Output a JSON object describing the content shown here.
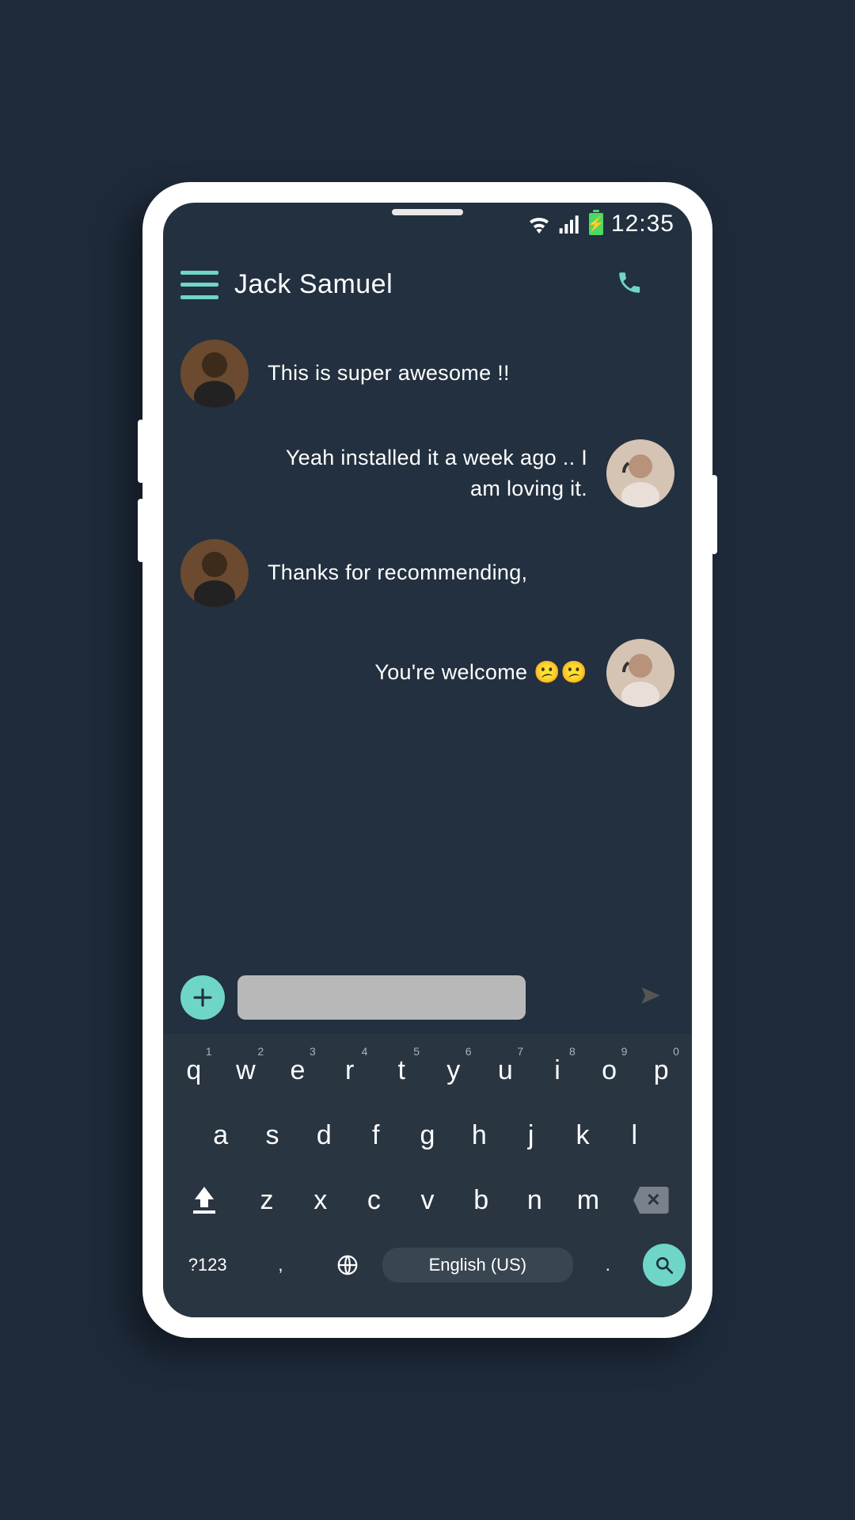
{
  "status": {
    "time": "12:35"
  },
  "header": {
    "contact_name": "Jack Samuel"
  },
  "messages": [
    {
      "dir": "in",
      "text": "This is super awesome !!"
    },
    {
      "dir": "out",
      "text": "Yeah installed it a week ago .. I am loving it."
    },
    {
      "dir": "in",
      "text": "Thanks for recommending,"
    },
    {
      "dir": "out",
      "text": "You're welcome 😕😕"
    }
  ],
  "input": {
    "value": ""
  },
  "keyboard": {
    "row1": [
      {
        "k": "q",
        "s": "1"
      },
      {
        "k": "w",
        "s": "2"
      },
      {
        "k": "e",
        "s": "3"
      },
      {
        "k": "r",
        "s": "4"
      },
      {
        "k": "t",
        "s": "5"
      },
      {
        "k": "y",
        "s": "6"
      },
      {
        "k": "u",
        "s": "7"
      },
      {
        "k": "i",
        "s": "8"
      },
      {
        "k": "o",
        "s": "9"
      },
      {
        "k": "p",
        "s": "0"
      }
    ],
    "row2": [
      "a",
      "s",
      "d",
      "f",
      "g",
      "h",
      "j",
      "k",
      "l"
    ],
    "row3": [
      "z",
      "x",
      "c",
      "v",
      "b",
      "n",
      "m"
    ],
    "sym_label": "?123",
    "comma": ",",
    "period": ".",
    "lang_label": "English (US)"
  }
}
